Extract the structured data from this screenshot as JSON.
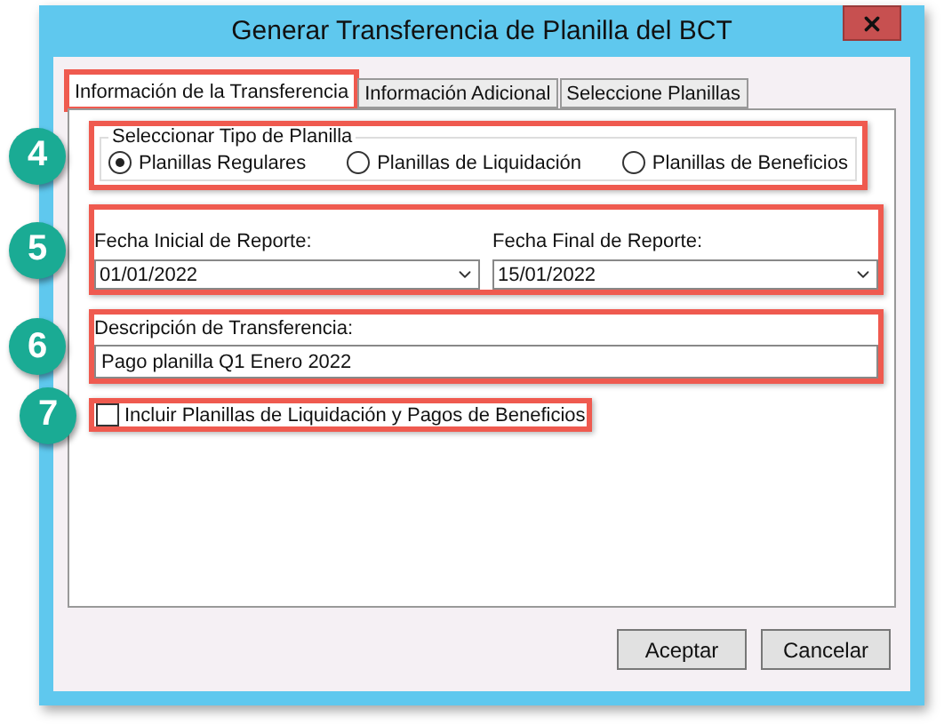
{
  "window": {
    "title": "Generar Transferencia de Planilla del BCT"
  },
  "tabs": [
    {
      "label": "Información de la Transferencia",
      "selected": true,
      "highlighted": true
    },
    {
      "label": "Información Adicional",
      "selected": false,
      "highlighted": false
    },
    {
      "label": "Seleccione Planillas",
      "selected": false,
      "highlighted": false
    }
  ],
  "plan_type": {
    "callout": "4",
    "legend": "Seleccionar Tipo de Planilla",
    "options": [
      {
        "label": "Planillas Regulares",
        "selected": true
      },
      {
        "label": "Planillas de Liquidación",
        "selected": false
      },
      {
        "label": "Planillas de Beneficios",
        "selected": false
      }
    ]
  },
  "dates": {
    "callout": "5",
    "fields": [
      {
        "label": "Fecha Inicial de Reporte:",
        "value": "01/01/2022"
      },
      {
        "label": "Fecha Final de Reporte:",
        "value": "15/01/2022"
      }
    ]
  },
  "description": {
    "callout": "6",
    "label": "Descripción de Transferencia:",
    "value": "Pago planilla Q1 Enero 2022"
  },
  "include": {
    "callout": "7",
    "label": "Incluir Planillas de Liquidación y Pagos de Beneficios",
    "checked": false
  },
  "buttons": [
    "Aceptar",
    "Cancelar"
  ]
}
